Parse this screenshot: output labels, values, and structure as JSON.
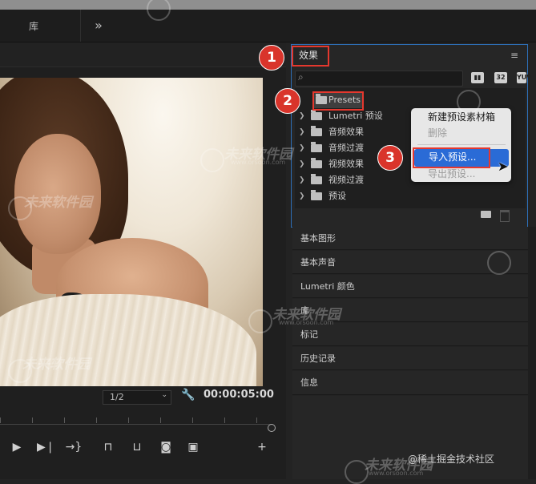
{
  "tabs": {
    "library": "库",
    "more": "»"
  },
  "monitor": {
    "zoom": "1/2",
    "timecode": "00:00:05:00",
    "transport_icons": [
      "play-icon",
      "step-forward-icon",
      "go-to-out-icon",
      "insert-icon",
      "overwrite-icon",
      "camera-icon",
      "compare-icon",
      "add-icon"
    ]
  },
  "effects_panel": {
    "title": "效果",
    "menu_icon": "≡",
    "search_placeholder": "",
    "filter_labels": [
      "32",
      "YUV"
    ],
    "tree": [
      {
        "label": "Presets",
        "selected": true
      },
      {
        "label": "Lumetri 预设"
      },
      {
        "label": "音频效果"
      },
      {
        "label": "音频过渡"
      },
      {
        "label": "视频效果"
      },
      {
        "label": "视频过渡"
      },
      {
        "label": "预设"
      }
    ]
  },
  "context_menu": {
    "items": [
      {
        "label": "新建预设素材箱",
        "enabled": true
      },
      {
        "label": "删除",
        "enabled": false
      },
      {
        "label": "导入预设...",
        "enabled": true,
        "highlighted": true
      },
      {
        "label": "导出预设...",
        "enabled": false
      }
    ]
  },
  "badges": [
    "1",
    "2",
    "3"
  ],
  "side_panels": [
    "基本图形",
    "基本声音",
    "Lumetri 颜色",
    "库",
    "标记",
    "历史记录",
    "信息"
  ],
  "watermark": {
    "text": "未来软件园",
    "url": "www.orsoon.com"
  },
  "attribution": "@稀土掘金技术社区",
  "colors": {
    "highlight": "#e5382e",
    "selection": "#2a6bd6",
    "panel_border": "#2d6fb8"
  }
}
